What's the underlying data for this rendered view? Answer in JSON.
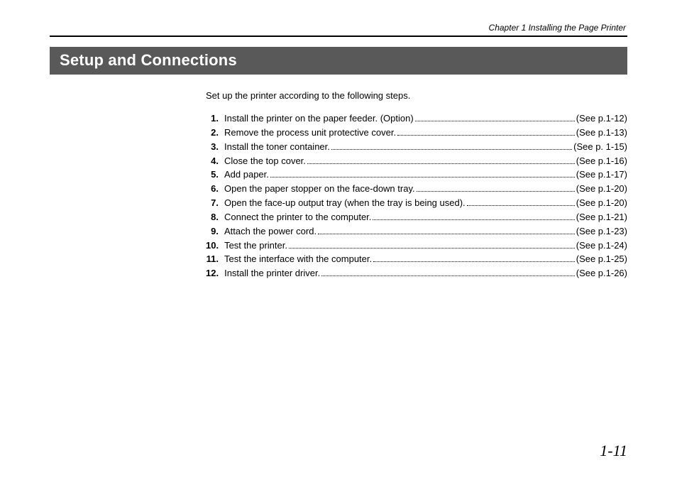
{
  "header": {
    "chapter_line": "Chapter 1  Installing the Page Printer"
  },
  "title": "Setup and Connections",
  "intro": "Set up the printer according to the following steps.",
  "steps": [
    {
      "num": "1.",
      "text": "Install the printer on the paper feeder. (Option)",
      "ref": "(See p.1-12)"
    },
    {
      "num": "2.",
      "text": "Remove the process unit protective cover. ",
      "ref": "(See p.1-13)"
    },
    {
      "num": "3.",
      "text": "Install the toner container. ",
      "ref": "(See p. 1-15)"
    },
    {
      "num": "4.",
      "text": "Close the top cover. ",
      "ref": "(See p.1-16)"
    },
    {
      "num": "5.",
      "text": "Add paper. ",
      "ref": "(See p.1-17)"
    },
    {
      "num": "6.",
      "text": "Open the paper stopper on the face-down tray. ",
      "ref": "(See p.1-20)"
    },
    {
      "num": "7.",
      "text": "Open the face-up output tray (when the tray is being used). ",
      "ref": "(See p.1-20)"
    },
    {
      "num": "8.",
      "text": "Connect the printer to the computer. ",
      "ref": "(See p.1-21)"
    },
    {
      "num": "9.",
      "text": "Attach the power cord. ",
      "ref": "(See p.1-23)"
    },
    {
      "num": "10.",
      "text": "Test the printer. ",
      "ref": "(See p.1-24)"
    },
    {
      "num": "11.",
      "text": "Test the interface with the computer. ",
      "ref": "(See p.1-25)"
    },
    {
      "num": "12.",
      "text": "Install the printer driver. ",
      "ref": "(See p.1-26)"
    }
  ],
  "page_number": "1-11"
}
